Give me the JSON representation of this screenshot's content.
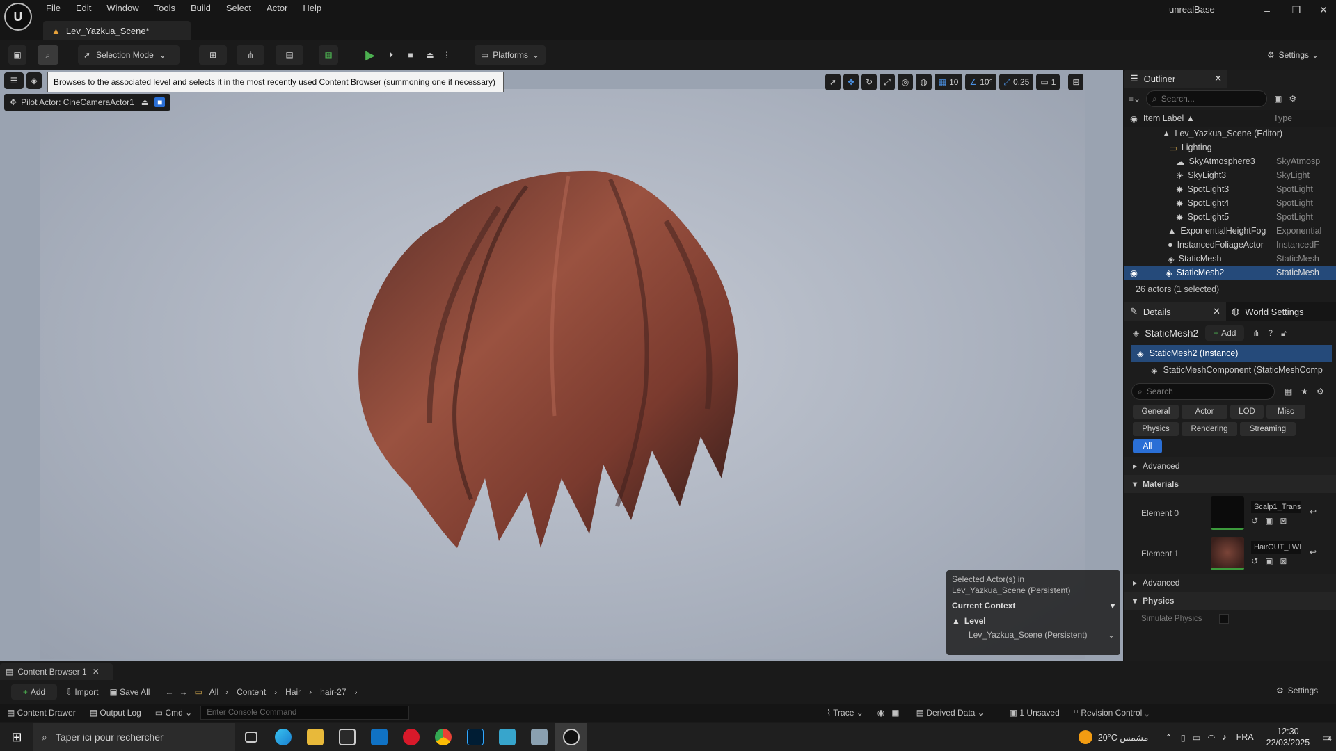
{
  "window": {
    "app_title": "unrealBase",
    "doc_tab": "Lev_Yazkua_Scene*"
  },
  "menu": [
    "File",
    "Edit",
    "Window",
    "Tools",
    "Build",
    "Select",
    "Actor",
    "Help"
  ],
  "toolbar": {
    "selection_mode": "Selection Mode",
    "platforms": "Platforms",
    "settings": "Settings"
  },
  "viewport": {
    "tooltip": "Browses to the associated level and selects it in the most recently used Content Browser (summoning one if necessary)",
    "pilot_actor": "Pilot Actor: CineCameraActor1",
    "grid_snap": "10",
    "rot_snap": "10°",
    "scale_snap": "0,25",
    "camera_speed": "1"
  },
  "context": {
    "selected_line1": "Selected Actor(s) in",
    "selected_line2": "Lev_Yazkua_Scene (Persistent)",
    "current_context": "Current Context",
    "level_label": "Level",
    "level_value": "Lev_Yazkua_Scene (Persistent)"
  },
  "outliner": {
    "title": "Outliner",
    "search_placeholder": "Search...",
    "col_label": "Item Label ▲",
    "col_type": "Type",
    "items": [
      {
        "label": "Lev_Yazkua_Scene (Editor)",
        "type": ""
      },
      {
        "label": "Lighting",
        "type": ""
      },
      {
        "label": "SkyAtmosphere3",
        "type": "SkyAtmosp"
      },
      {
        "label": "SkyLight3",
        "type": "SkyLight"
      },
      {
        "label": "SpotLight3",
        "type": "SpotLight"
      },
      {
        "label": "SpotLight4",
        "type": "SpotLight"
      },
      {
        "label": "SpotLight5",
        "type": "SpotLight"
      },
      {
        "label": "ExponentialHeightFog",
        "type": "Exponential"
      },
      {
        "label": "InstancedFoliageActor",
        "type": "InstancedF"
      },
      {
        "label": "StaticMesh",
        "type": "StaticMesh"
      },
      {
        "label": "StaticMesh2",
        "type": "StaticMesh"
      }
    ],
    "count": "26 actors (1 selected)"
  },
  "details": {
    "tab": "Details",
    "world_tab": "World Settings",
    "object": "StaticMesh2",
    "add": "Add",
    "instance": "StaticMesh2 (Instance)",
    "component": "StaticMeshComponent (StaticMeshComp",
    "search_placeholder": "Search",
    "filters": [
      "General",
      "Actor",
      "LOD",
      "Misc",
      "Physics",
      "Rendering",
      "Streaming"
    ],
    "filter_all": "All",
    "advanced": "Advanced",
    "materials": "Materials",
    "element0": "Element 0",
    "element0_mat": "Scalp1_Trans",
    "element1": "Element 1",
    "element1_mat": "HairOUT_LWI",
    "advanced2": "Advanced",
    "physics": "Physics",
    "simulate": "Simulate Physics"
  },
  "content_browser": {
    "tab": "Content Browser 1",
    "add": "Add",
    "import": "Import",
    "save_all": "Save All",
    "path": [
      "All",
      "Content",
      "Hair",
      "hair-27"
    ],
    "settings": "Settings"
  },
  "statusbar": {
    "drawer": "Content Drawer",
    "output": "Output Log",
    "cmd": "Cmd",
    "console_placeholder": "Enter Console Command",
    "trace": "Trace",
    "derived": "Derived Data",
    "unsaved": "1 Unsaved",
    "revision": "Revision Control"
  },
  "taskbar": {
    "search_placeholder": "Taper ici pour rechercher",
    "weather": "20°C  مشمس",
    "lang": "FRA",
    "time": "12:30",
    "date": "22/03/2025",
    "notif": "4"
  }
}
